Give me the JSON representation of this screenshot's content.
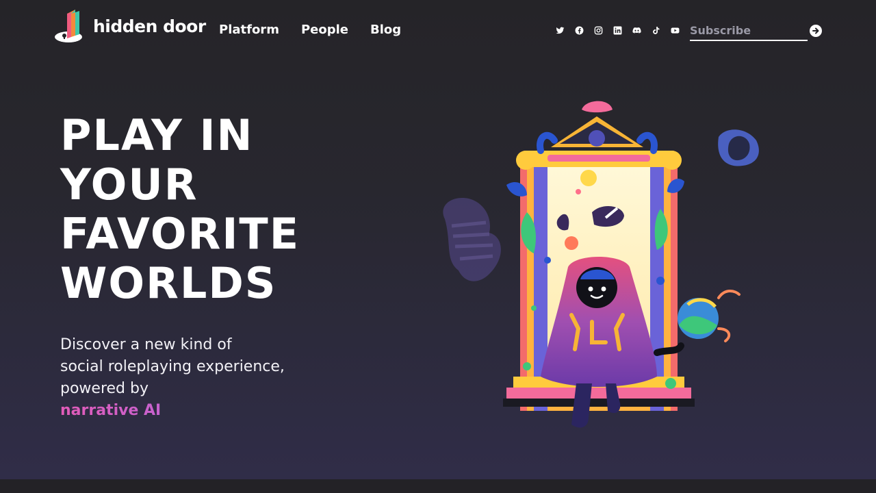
{
  "header": {
    "logo_text": "hidden door",
    "nav": [
      {
        "label": "Platform"
      },
      {
        "label": "People"
      },
      {
        "label": "Blog"
      }
    ],
    "socials": [
      {
        "icon": "twitter-icon"
      },
      {
        "icon": "facebook-icon"
      },
      {
        "icon": "instagram-icon"
      },
      {
        "icon": "linkedin-icon"
      },
      {
        "icon": "discord-icon"
      },
      {
        "icon": "tiktok-icon"
      },
      {
        "icon": "youtube-icon"
      }
    ],
    "subscribe_placeholder": "Subscribe"
  },
  "hero": {
    "title_lines": [
      "PLAY IN",
      "YOUR",
      "FAVORITE",
      "WORLDS"
    ],
    "subtitle_line1": "Discover a new kind of",
    "subtitle_line2": "social roleplaying experience,",
    "subtitle_line3_prefix": "powered by ",
    "subtitle_highlight": "narrative AI"
  },
  "colors": {
    "background": "#232226",
    "accent_pink": "#e25bb8",
    "accent_purple": "#9b6df2",
    "gradient_bottom": "#302d48"
  }
}
